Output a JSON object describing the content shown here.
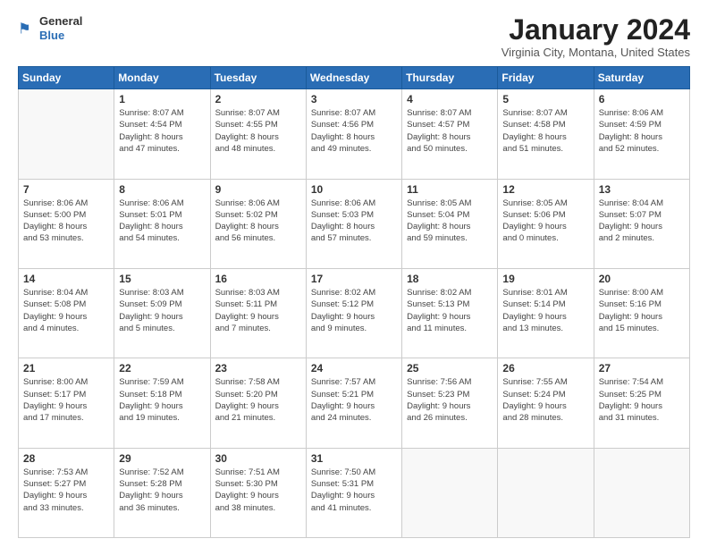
{
  "logo": {
    "general": "General",
    "blue": "Blue"
  },
  "header": {
    "title": "January 2024",
    "subtitle": "Virginia City, Montana, United States"
  },
  "weekdays": [
    "Sunday",
    "Monday",
    "Tuesday",
    "Wednesday",
    "Thursday",
    "Friday",
    "Saturday"
  ],
  "weeks": [
    [
      {
        "day": "",
        "info": ""
      },
      {
        "day": "1",
        "info": "Sunrise: 8:07 AM\nSunset: 4:54 PM\nDaylight: 8 hours\nand 47 minutes."
      },
      {
        "day": "2",
        "info": "Sunrise: 8:07 AM\nSunset: 4:55 PM\nDaylight: 8 hours\nand 48 minutes."
      },
      {
        "day": "3",
        "info": "Sunrise: 8:07 AM\nSunset: 4:56 PM\nDaylight: 8 hours\nand 49 minutes."
      },
      {
        "day": "4",
        "info": "Sunrise: 8:07 AM\nSunset: 4:57 PM\nDaylight: 8 hours\nand 50 minutes."
      },
      {
        "day": "5",
        "info": "Sunrise: 8:07 AM\nSunset: 4:58 PM\nDaylight: 8 hours\nand 51 minutes."
      },
      {
        "day": "6",
        "info": "Sunrise: 8:06 AM\nSunset: 4:59 PM\nDaylight: 8 hours\nand 52 minutes."
      }
    ],
    [
      {
        "day": "7",
        "info": "Sunrise: 8:06 AM\nSunset: 5:00 PM\nDaylight: 8 hours\nand 53 minutes."
      },
      {
        "day": "8",
        "info": "Sunrise: 8:06 AM\nSunset: 5:01 PM\nDaylight: 8 hours\nand 54 minutes."
      },
      {
        "day": "9",
        "info": "Sunrise: 8:06 AM\nSunset: 5:02 PM\nDaylight: 8 hours\nand 56 minutes."
      },
      {
        "day": "10",
        "info": "Sunrise: 8:06 AM\nSunset: 5:03 PM\nDaylight: 8 hours\nand 57 minutes."
      },
      {
        "day": "11",
        "info": "Sunrise: 8:05 AM\nSunset: 5:04 PM\nDaylight: 8 hours\nand 59 minutes."
      },
      {
        "day": "12",
        "info": "Sunrise: 8:05 AM\nSunset: 5:06 PM\nDaylight: 9 hours\nand 0 minutes."
      },
      {
        "day": "13",
        "info": "Sunrise: 8:04 AM\nSunset: 5:07 PM\nDaylight: 9 hours\nand 2 minutes."
      }
    ],
    [
      {
        "day": "14",
        "info": "Sunrise: 8:04 AM\nSunset: 5:08 PM\nDaylight: 9 hours\nand 4 minutes."
      },
      {
        "day": "15",
        "info": "Sunrise: 8:03 AM\nSunset: 5:09 PM\nDaylight: 9 hours\nand 5 minutes."
      },
      {
        "day": "16",
        "info": "Sunrise: 8:03 AM\nSunset: 5:11 PM\nDaylight: 9 hours\nand 7 minutes."
      },
      {
        "day": "17",
        "info": "Sunrise: 8:02 AM\nSunset: 5:12 PM\nDaylight: 9 hours\nand 9 minutes."
      },
      {
        "day": "18",
        "info": "Sunrise: 8:02 AM\nSunset: 5:13 PM\nDaylight: 9 hours\nand 11 minutes."
      },
      {
        "day": "19",
        "info": "Sunrise: 8:01 AM\nSunset: 5:14 PM\nDaylight: 9 hours\nand 13 minutes."
      },
      {
        "day": "20",
        "info": "Sunrise: 8:00 AM\nSunset: 5:16 PM\nDaylight: 9 hours\nand 15 minutes."
      }
    ],
    [
      {
        "day": "21",
        "info": "Sunrise: 8:00 AM\nSunset: 5:17 PM\nDaylight: 9 hours\nand 17 minutes."
      },
      {
        "day": "22",
        "info": "Sunrise: 7:59 AM\nSunset: 5:18 PM\nDaylight: 9 hours\nand 19 minutes."
      },
      {
        "day": "23",
        "info": "Sunrise: 7:58 AM\nSunset: 5:20 PM\nDaylight: 9 hours\nand 21 minutes."
      },
      {
        "day": "24",
        "info": "Sunrise: 7:57 AM\nSunset: 5:21 PM\nDaylight: 9 hours\nand 24 minutes."
      },
      {
        "day": "25",
        "info": "Sunrise: 7:56 AM\nSunset: 5:23 PM\nDaylight: 9 hours\nand 26 minutes."
      },
      {
        "day": "26",
        "info": "Sunrise: 7:55 AM\nSunset: 5:24 PM\nDaylight: 9 hours\nand 28 minutes."
      },
      {
        "day": "27",
        "info": "Sunrise: 7:54 AM\nSunset: 5:25 PM\nDaylight: 9 hours\nand 31 minutes."
      }
    ],
    [
      {
        "day": "28",
        "info": "Sunrise: 7:53 AM\nSunset: 5:27 PM\nDaylight: 9 hours\nand 33 minutes."
      },
      {
        "day": "29",
        "info": "Sunrise: 7:52 AM\nSunset: 5:28 PM\nDaylight: 9 hours\nand 36 minutes."
      },
      {
        "day": "30",
        "info": "Sunrise: 7:51 AM\nSunset: 5:30 PM\nDaylight: 9 hours\nand 38 minutes."
      },
      {
        "day": "31",
        "info": "Sunrise: 7:50 AM\nSunset: 5:31 PM\nDaylight: 9 hours\nand 41 minutes."
      },
      {
        "day": "",
        "info": ""
      },
      {
        "day": "",
        "info": ""
      },
      {
        "day": "",
        "info": ""
      }
    ]
  ]
}
